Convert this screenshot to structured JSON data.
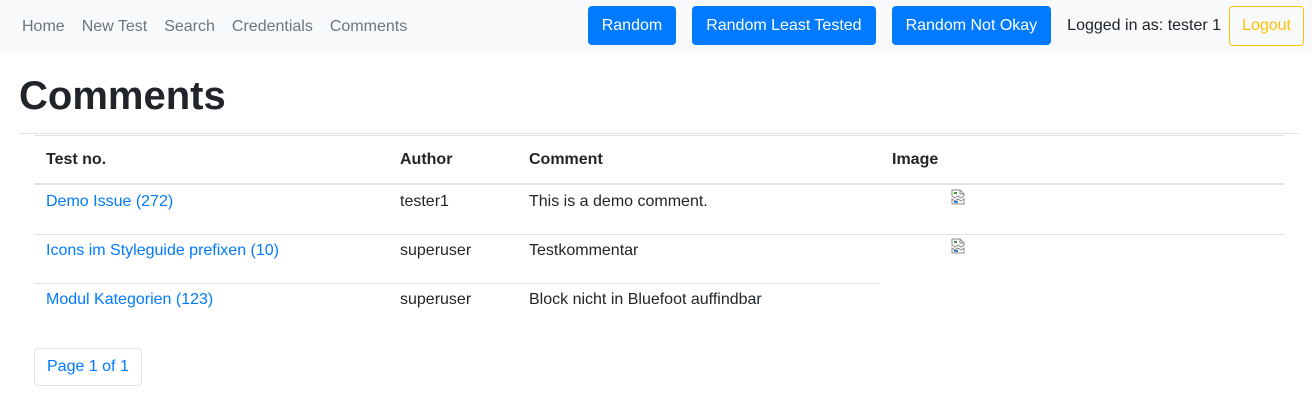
{
  "nav": {
    "links": [
      "Home",
      "New Test",
      "Search",
      "Credentials",
      "Comments"
    ],
    "buttons": [
      "Random",
      "Random Least Tested",
      "Random Not Okay"
    ],
    "logged_in_text": "Logged in as: tester 1",
    "logout_label": "Logout"
  },
  "page": {
    "title": "Comments"
  },
  "table": {
    "headers": {
      "test_no": "Test no.",
      "author": "Author",
      "comment": "Comment",
      "image": "Image"
    },
    "rows": [
      {
        "test": "Demo Issue (272)",
        "author": "tester1",
        "comment": "This is a demo comment.",
        "image": "broken-image-icon"
      },
      {
        "test": "Icons im Styleguide prefixen (10)",
        "author": "superuser",
        "comment": "Testkommentar",
        "image": "broken-image-icon"
      },
      {
        "test": "Modul Kategorien (123)",
        "author": "superuser",
        "comment": "Block nicht in Bluefoot auffindbar",
        "image": ""
      }
    ]
  },
  "pagination": {
    "label": "Page 1 of 1"
  },
  "colors": {
    "primary": "#007bff",
    "warning": "#ffc107",
    "navbar_bg": "#f8f9fa",
    "muted": "#6c757d"
  }
}
